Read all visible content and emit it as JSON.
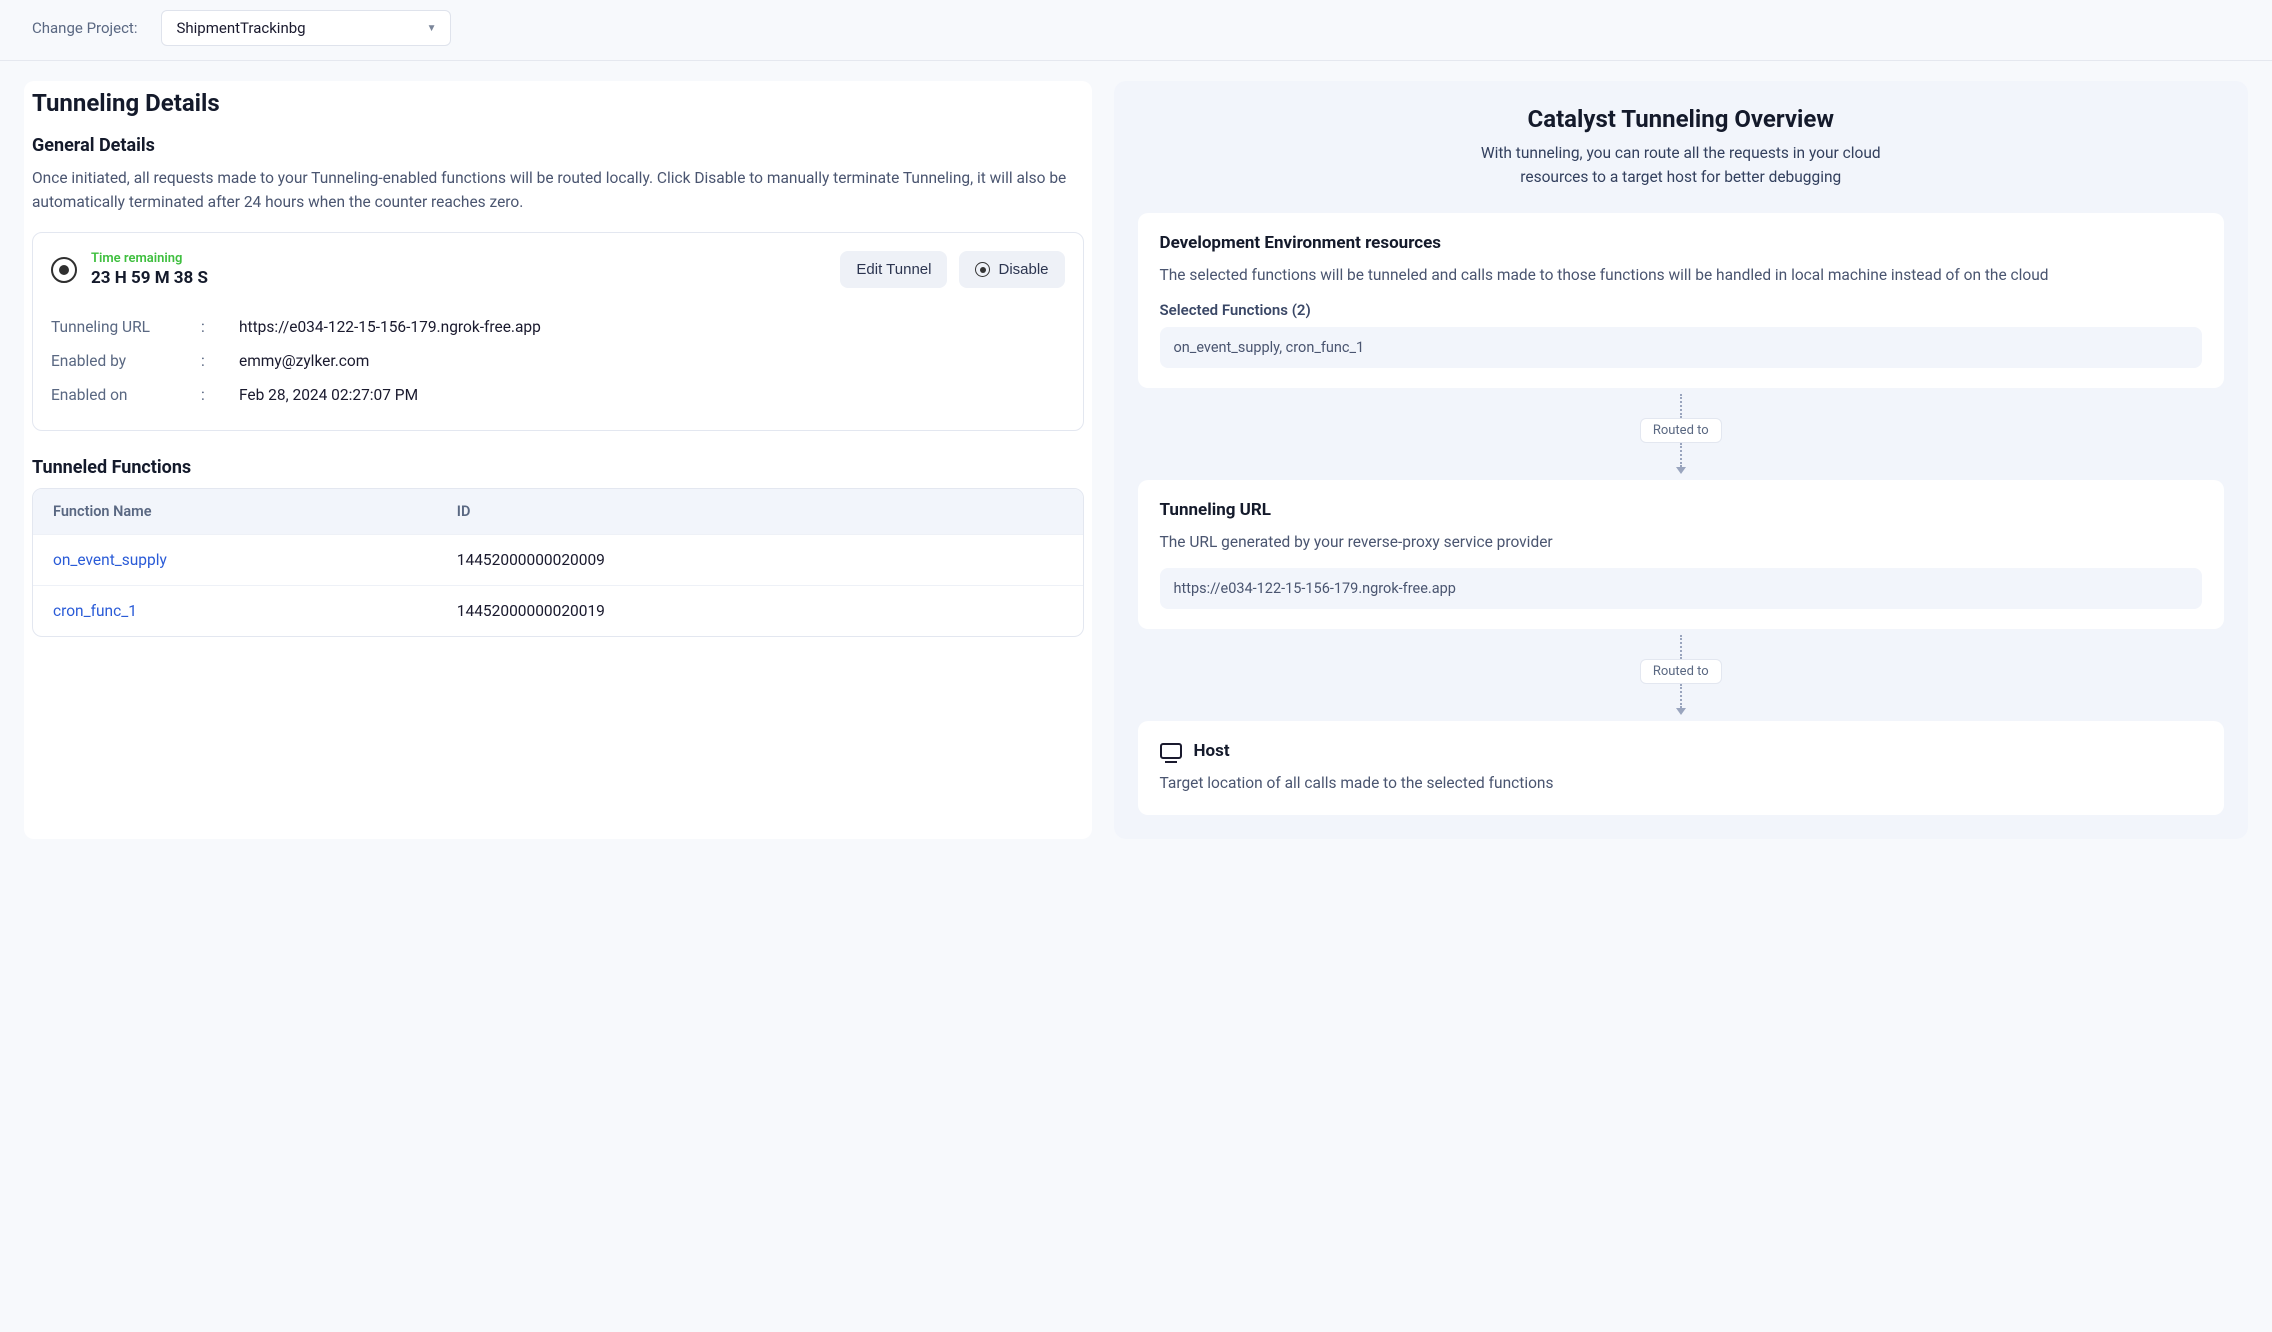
{
  "header": {
    "change_project_label": "Change Project:",
    "project_value": "ShipmentTrackinbg"
  },
  "left": {
    "page_title": "Tunneling Details",
    "general_title": "General Details",
    "general_desc": "Once initiated, all requests made to your Tunneling-enabled functions will be routed locally. Click Disable to manually terminate Tunneling, it will also be automatically terminated after 24 hours when the counter reaches zero.",
    "time_label": "Time remaining",
    "time_value": "23 H 59 M 38 S",
    "edit_label": "Edit Tunnel",
    "disable_label": "Disable",
    "kv": {
      "url_key": "Tunneling URL",
      "url_val": "https://e034-122-15-156-179.ngrok-free.app",
      "enabled_by_key": "Enabled by",
      "enabled_by_val": "emmy@zylker.com",
      "enabled_on_key": "Enabled on",
      "enabled_on_val": "Feb 28, 2024 02:27:07 PM"
    },
    "functions_title": "Tunneled Functions",
    "col_name": "Function Name",
    "col_id": "ID",
    "rows": [
      {
        "name": "on_event_supply",
        "id": "14452000000020009"
      },
      {
        "name": "cron_func_1",
        "id": "14452000000020019"
      }
    ]
  },
  "right": {
    "overview_title": "Catalyst Tunneling Overview",
    "overview_desc": "With tunneling, you can route all the requests in your cloud resources to a target host for better debugging",
    "card1": {
      "title": "Development Environment resources",
      "desc": "The selected functions will be tunneled and calls made to those functions will be handled in local machine instead of on the cloud",
      "sub_label": "Selected Functions  (2)",
      "value": "on_event_supply, cron_func_1"
    },
    "routed_to": "Routed to",
    "card2": {
      "title": "Tunneling URL",
      "desc": "The URL generated by your reverse-proxy service provider",
      "value": "https://e034-122-15-156-179.ngrok-free.app"
    },
    "card3": {
      "title": "Host",
      "desc": "Target location of all calls made to the selected functions"
    }
  }
}
